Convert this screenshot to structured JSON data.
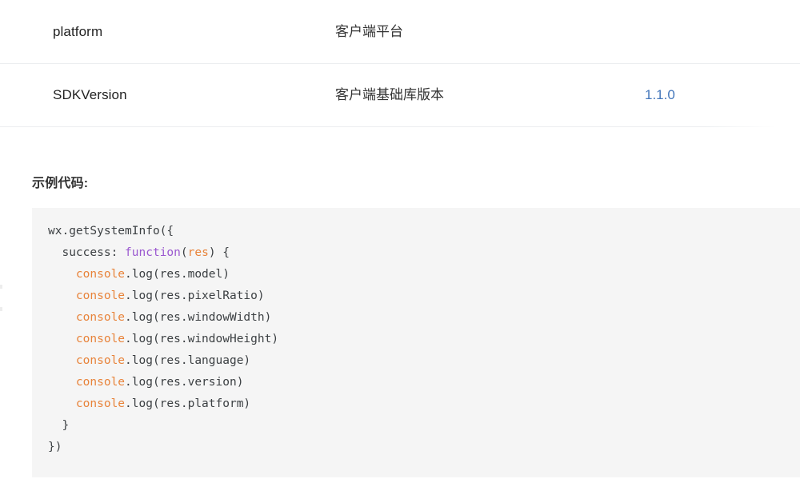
{
  "table": {
    "rows": [
      {
        "name": "platform",
        "description": "客户端平台",
        "value": ""
      },
      {
        "name": "SDKVersion",
        "description": "客户端基础库版本",
        "value": "1.1.0"
      }
    ]
  },
  "sample": {
    "heading": "示例代码:",
    "code_lines": [
      {
        "indent": 0,
        "parts": [
          {
            "type": "plain",
            "text": "wx.getSystemInfo({"
          }
        ]
      },
      {
        "indent": 1,
        "parts": [
          {
            "type": "plain",
            "text": "success: "
          },
          {
            "type": "function",
            "text": "function"
          },
          {
            "type": "plain",
            "text": "("
          },
          {
            "type": "param",
            "text": "res"
          },
          {
            "type": "plain",
            "text": ") {"
          }
        ]
      },
      {
        "indent": 2,
        "parts": [
          {
            "type": "console",
            "text": "console"
          },
          {
            "type": "plain",
            "text": ".log(res.model)"
          }
        ]
      },
      {
        "indent": 2,
        "parts": [
          {
            "type": "console",
            "text": "console"
          },
          {
            "type": "plain",
            "text": ".log(res.pixelRatio)"
          }
        ]
      },
      {
        "indent": 2,
        "parts": [
          {
            "type": "console",
            "text": "console"
          },
          {
            "type": "plain",
            "text": ".log(res.windowWidth)"
          }
        ]
      },
      {
        "indent": 2,
        "parts": [
          {
            "type": "console",
            "text": "console"
          },
          {
            "type": "plain",
            "text": ".log(res.windowHeight)"
          }
        ]
      },
      {
        "indent": 2,
        "parts": [
          {
            "type": "console",
            "text": "console"
          },
          {
            "type": "plain",
            "text": ".log(res.language)"
          }
        ]
      },
      {
        "indent": 2,
        "parts": [
          {
            "type": "console",
            "text": "console"
          },
          {
            "type": "plain",
            "text": ".log(res.version)"
          }
        ]
      },
      {
        "indent": 2,
        "parts": [
          {
            "type": "console",
            "text": "console"
          },
          {
            "type": "plain",
            "text": ".log(res.platform)"
          }
        ]
      },
      {
        "indent": 1,
        "parts": [
          {
            "type": "plain",
            "text": "}"
          }
        ]
      },
      {
        "indent": 0,
        "parts": [
          {
            "type": "plain",
            "text": "})"
          }
        ]
      }
    ]
  },
  "colors": {
    "link": "#4477bb",
    "code_background": "#f5f5f5",
    "code_console": "#e8833a",
    "code_keyword": "#9b59d0",
    "code_param": "#e8833a",
    "code_text": "#3c4043",
    "divider": "#eceef0"
  }
}
